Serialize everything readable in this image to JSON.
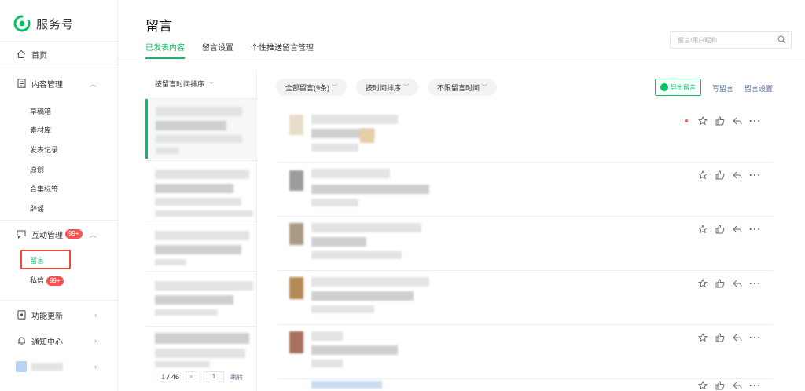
{
  "brand": {
    "name": "服务号"
  },
  "sidebar": {
    "home": "首页",
    "content_mgmt": "内容管理",
    "content_sub": [
      "草稿箱",
      "素材库",
      "发表记录",
      "原创",
      "合集标签",
      "辟谣"
    ],
    "interact_mgmt": "互动管理",
    "interact_badge": "99+",
    "active_sub": "留言",
    "private_msg": "私信",
    "private_badge": "99+",
    "feature_update": "功能更新",
    "notify_center": "通知中心"
  },
  "header": {
    "title": "留言",
    "tabs": [
      "已发表内容",
      "留言设置",
      "个性推送留言管理"
    ],
    "search_placeholder": "留言/用户昵称"
  },
  "list": {
    "sort_label": "按留言时间排序",
    "pager_current": "1",
    "pager_total": "/ 46",
    "page_input": "1",
    "jump": "跳转"
  },
  "filters": {
    "all": "全部留言(9条)",
    "by_time": "按时间排序",
    "range": "不限留言时间"
  },
  "toolbar": {
    "export": "导出留言",
    "write": "写留言",
    "settings": "留言设置"
  },
  "colors": {
    "accent": "#07c160",
    "badge": "#fa5151",
    "link": "#576b95"
  }
}
